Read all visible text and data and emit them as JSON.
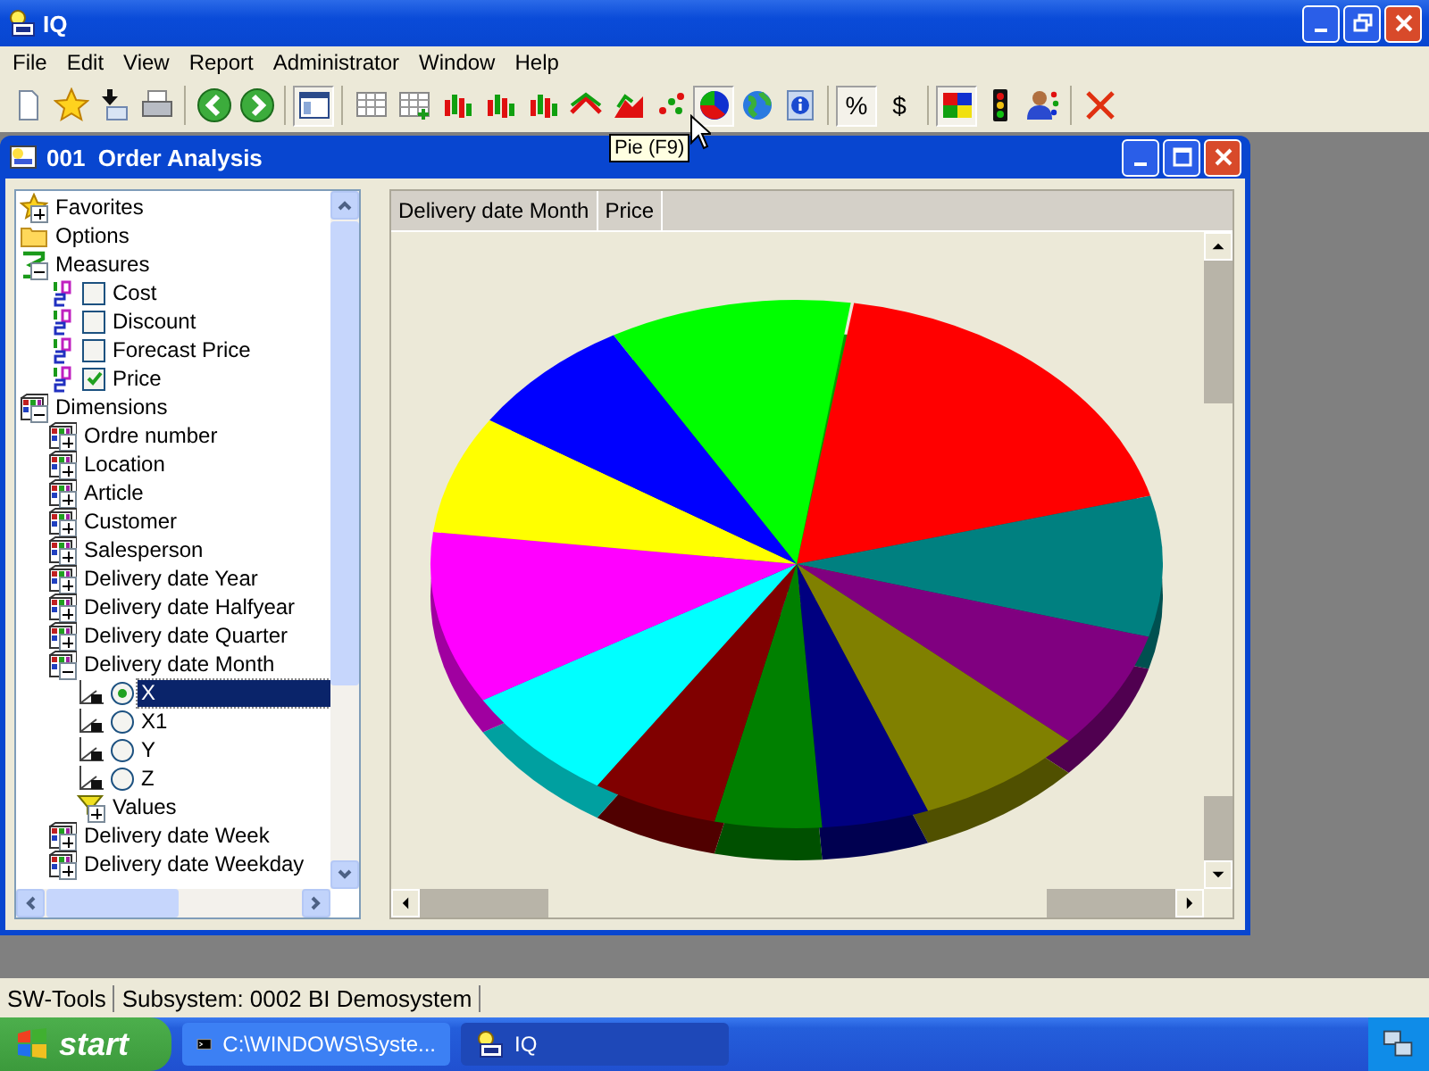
{
  "window": {
    "title": "IQ"
  },
  "menu": [
    "File",
    "Edit",
    "View",
    "Report",
    "Administrator",
    "Window",
    "Help"
  ],
  "toolbar": [
    {
      "kind": "new",
      "pressed": false
    },
    {
      "kind": "favorite",
      "pressed": false
    },
    {
      "kind": "import",
      "pressed": false
    },
    {
      "kind": "print",
      "pressed": false
    },
    {
      "kind": "separator"
    },
    {
      "kind": "back",
      "pressed": false
    },
    {
      "kind": "forward",
      "pressed": false
    },
    {
      "kind": "separator"
    },
    {
      "kind": "layout",
      "pressed": true
    },
    {
      "kind": "separator"
    },
    {
      "kind": "table",
      "pressed": false
    },
    {
      "kind": "table-add",
      "pressed": false
    },
    {
      "kind": "bars",
      "pressed": false
    },
    {
      "kind": "bars",
      "pressed": false
    },
    {
      "kind": "bars",
      "pressed": false
    },
    {
      "kind": "line",
      "pressed": false
    },
    {
      "kind": "area",
      "pressed": false
    },
    {
      "kind": "scatter",
      "pressed": false
    },
    {
      "kind": "pie",
      "pressed": true
    },
    {
      "kind": "globe",
      "pressed": false
    },
    {
      "kind": "info",
      "pressed": false
    },
    {
      "kind": "separator"
    },
    {
      "kind": "text",
      "label": "%",
      "pressed": true
    },
    {
      "kind": "text",
      "label": "$",
      "pressed": false
    },
    {
      "kind": "separator"
    },
    {
      "kind": "colors",
      "pressed": true
    },
    {
      "kind": "traffic",
      "pressed": false
    },
    {
      "kind": "users",
      "pressed": false
    },
    {
      "kind": "separator"
    },
    {
      "kind": "close",
      "pressed": false
    }
  ],
  "tooltip": "Pie (F9)",
  "child_window": {
    "title": "001  Order Analysis"
  },
  "tree": [
    {
      "kind": "favorites",
      "label": "Favorites",
      "expanded": false
    },
    {
      "kind": "folder",
      "label": "Options"
    },
    {
      "kind": "measures",
      "label": "Measures",
      "expanded": true,
      "children": [
        {
          "kind": "measure",
          "label": "Cost",
          "checked": false
        },
        {
          "kind": "measure",
          "label": "Discount",
          "checked": false
        },
        {
          "kind": "measure",
          "label": "Forecast Price",
          "checked": false
        },
        {
          "kind": "measure",
          "label": "Price",
          "checked": true
        }
      ]
    },
    {
      "kind": "dimensions",
      "label": "Dimensions",
      "expanded": true,
      "children": [
        {
          "kind": "dimension",
          "label": "Ordre number",
          "expanded": false
        },
        {
          "kind": "dimension",
          "label": "Location",
          "expanded": false
        },
        {
          "kind": "dimension",
          "label": "Article",
          "expanded": false
        },
        {
          "kind": "dimension",
          "label": "Customer",
          "expanded": false
        },
        {
          "kind": "dimension",
          "label": "Salesperson",
          "expanded": false
        },
        {
          "kind": "dimension",
          "label": "Delivery date Year",
          "expanded": false
        },
        {
          "kind": "dimension",
          "label": "Delivery date Halfyear",
          "expanded": false
        },
        {
          "kind": "dimension",
          "label": "Delivery date Quarter",
          "expanded": false
        },
        {
          "kind": "dimension",
          "label": "Delivery date Month",
          "expanded": true,
          "children": [
            {
              "kind": "axis",
              "label": "X",
              "selected": true
            },
            {
              "kind": "axis",
              "label": "X1",
              "selected": false
            },
            {
              "kind": "axis",
              "label": "Y",
              "selected": false
            },
            {
              "kind": "axis",
              "label": "Z",
              "selected": false
            },
            {
              "kind": "filter",
              "label": "Values",
              "expanded": false
            }
          ]
        },
        {
          "kind": "dimension",
          "label": "Delivery date Week",
          "expanded": false
        },
        {
          "kind": "dimension",
          "label": "Delivery date Weekday",
          "expanded": false
        }
      ]
    }
  ],
  "grid": {
    "columns": [
      "Delivery date Month",
      "Price"
    ]
  },
  "status_bar": [
    "SW-Tools",
    "Subsystem: 0002 BI Demosystem"
  ],
  "taskbar": {
    "start": "start",
    "tasks": [
      {
        "kind": "console",
        "label": "C:\\WINDOWS\\Syste...",
        "selected": false
      },
      {
        "kind": "app",
        "label": "IQ",
        "selected": true
      }
    ]
  }
}
